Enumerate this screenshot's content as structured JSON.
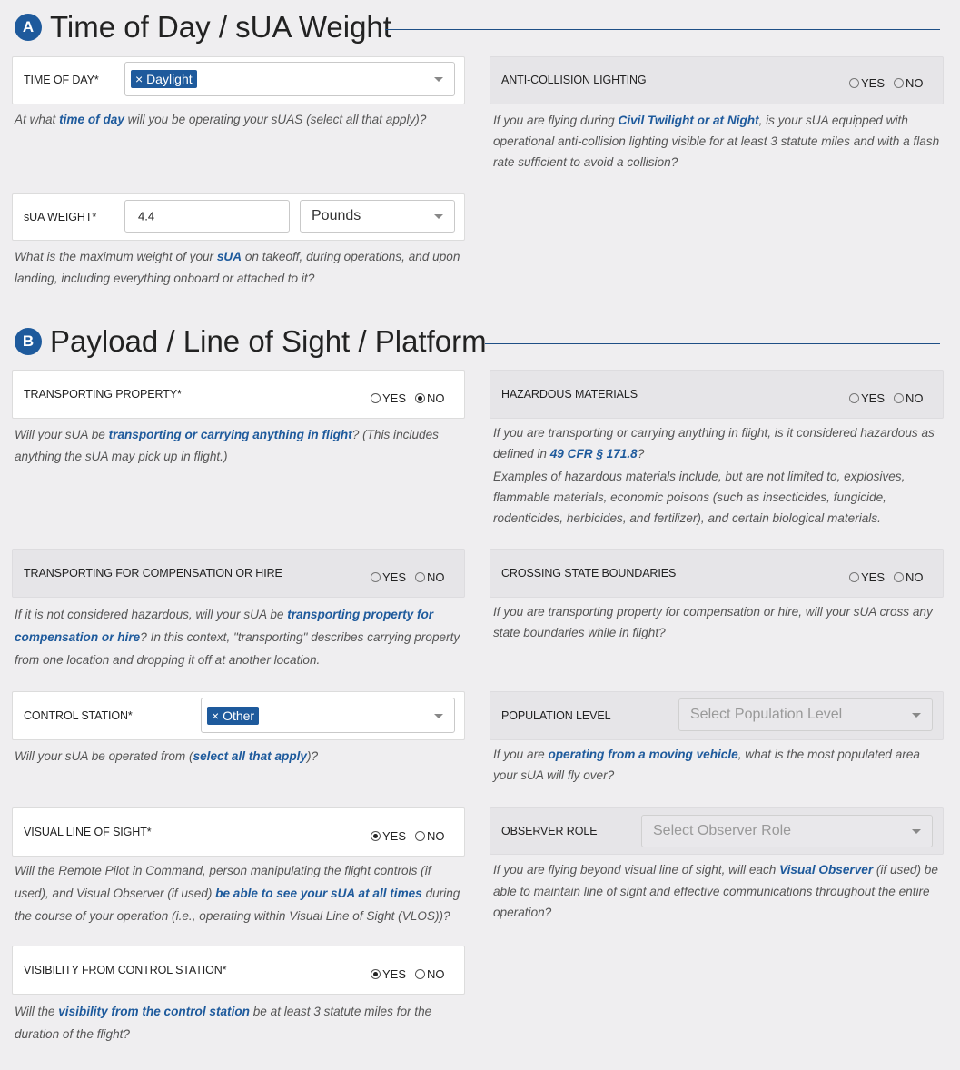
{
  "section_a": {
    "badge": "A",
    "title": "Time of Day / sUA Weight",
    "time_of_day": {
      "label": "TIME OF DAY*",
      "tag": "× Daylight",
      "help": [
        "At what ",
        "time of day",
        " will you be operating your sUAS (select all that apply)?"
      ]
    },
    "anti_collision": {
      "label": "ANTI-COLLISION LIGHTING",
      "yes": "YES",
      "no": "NO",
      "help": [
        "If you are flying during ",
        "Civil Twilight or at Night",
        ", is your sUA equipped with operational anti-collision lighting visible for at least 3 statute miles and with a flash rate sufficient to avoid a collision?"
      ]
    },
    "weight": {
      "label": "sUA WEIGHT*",
      "value": "4.4",
      "unit": "Pounds",
      "help": [
        "What is the maximum weight of your ",
        "sUA",
        " on takeoff, during operations, and upon landing, including everything onboard or attached to it?"
      ]
    }
  },
  "section_b": {
    "badge": "B",
    "title": "Payload / Line of Sight / Platform",
    "transporting_property": {
      "label": "TRANSPORTING PROPERTY*",
      "yes": "YES",
      "no": "NO",
      "selected": "NO",
      "help": [
        "Will your sUA be ",
        "transporting or carrying anything in flight",
        "? (This includes anything the sUA may pick up in flight.)"
      ]
    },
    "hazardous": {
      "label": "HAZARDOUS MATERIALS",
      "yes": "YES",
      "no": "NO",
      "help": [
        "If you are transporting or carrying anything in flight, is it considered hazardous as defined in ",
        "49 CFR § 171.8",
        "?"
      ],
      "help2": "Examples of hazardous materials include, but are not limited to, explosives, flammable materials, economic poisons (such as insecticides, fungicide, rodenticides, herbicides, and fertilizer), and certain biological materials."
    },
    "compensation": {
      "label": "TRANSPORTING FOR COMPENSATION OR HIRE",
      "yes": "YES",
      "no": "NO",
      "help": [
        "If it is not considered hazardous, will your sUA be ",
        "transporting property for compensation or hire",
        "? In this context, \"transporting\" describes carrying property from one location and dropping it off at another location."
      ]
    },
    "state_boundaries": {
      "label": "CROSSING STATE BOUNDARIES",
      "yes": "YES",
      "no": "NO",
      "help": "If you are transporting property for compensation or hire, will your sUA cross any state boundaries while in flight?"
    },
    "control_station": {
      "label": "CONTROL STATION*",
      "tag": "× Other",
      "help": [
        "Will your sUA be operated from (",
        "select all that apply",
        ")?"
      ]
    },
    "population": {
      "label": "POPULATION LEVEL",
      "placeholder": "Select Population Level",
      "help": [
        "If you are ",
        "operating from a moving vehicle",
        ", what is the most populated area your sUA will fly over?"
      ]
    },
    "vlos": {
      "label": "VISUAL LINE OF SIGHT*",
      "yes": "YES",
      "no": "NO",
      "selected": "YES",
      "help": [
        "Will the Remote Pilot in Command, person manipulating the flight controls (if used), and Visual Observer (if used) ",
        "be able to see your sUA at all times",
        " during the course of your operation (i.e., operating within Visual Line of Sight (VLOS))?"
      ]
    },
    "observer": {
      "label": "OBSERVER ROLE",
      "placeholder": "Select Observer Role",
      "help": [
        "If you are flying beyond visual line of sight, will each ",
        "Visual Observer",
        " (if used) be able to maintain line of sight and effective communications throughout the entire operation?"
      ]
    },
    "visibility": {
      "label": "VISIBILITY FROM CONTROL STATION*",
      "yes": "YES",
      "no": "NO",
      "selected": "YES",
      "help": [
        "Will the ",
        "visibility from the control station",
        " be at least 3 statute miles for the duration of the flight?"
      ]
    }
  },
  "colors": {
    "accent": "#1e5a9c",
    "background": "#efeef0"
  }
}
